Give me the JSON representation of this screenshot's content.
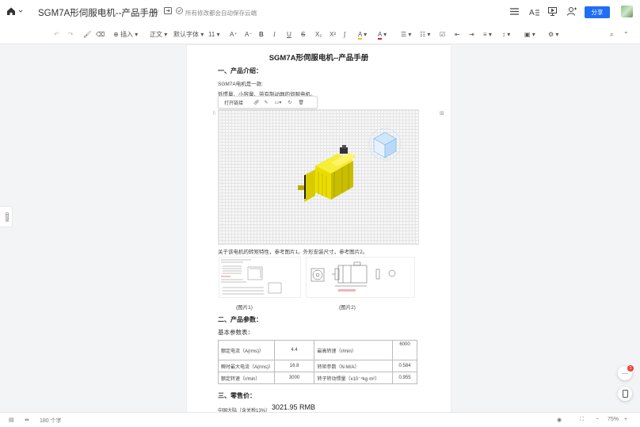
{
  "titlebar": {
    "title": "SGM7A形伺服电机--产品手册",
    "save_status": "所有修改都会自动保存云端",
    "share_label": "分享"
  },
  "toolbar": {
    "insert_label": "插入",
    "style_label": "正文",
    "font_label": "默认字体",
    "size_label": "11"
  },
  "document": {
    "heading": "SGM7A形伺服电机--产品手册",
    "section1_title": "一、产品介绍：",
    "intro_line1": "SGM7A电机是一款:",
    "intro_line2": "低惯量、小容量、带有制动器的伺服电机。",
    "image_popup": {
      "open_link": "打开链接"
    },
    "ref_text": "关于该电机的转矩特性，参考图片1。外形安装尺寸，参考图片2。",
    "caption1": "(图片1)",
    "caption2": "(图片2)",
    "section2_title": "二、产品参数：",
    "basic_params": "基本参数表：",
    "table": [
      [
        "额定电流（A(rms)）",
        "4.4",
        "最高转速（r/min）",
        "6000"
      ],
      [
        "瞬时最大电流（A(rms)）",
        "16.8",
        "转矩参数（N·M/A）",
        "0.584"
      ],
      [
        "额定转速（r/min）",
        "3000",
        "转子转动惯量（x10⁻⁴kg·m²）",
        "0.955"
      ]
    ],
    "section3_title": "三、零售价：",
    "price_label": "中国大陆（含关税13%）",
    "price_value": "3021.95   RMB"
  },
  "sidebar": {
    "outline_label": "目录"
  },
  "notifications": {
    "count": "1"
  },
  "statusbar": {
    "word_count": "180 个字",
    "zoom": "75%"
  },
  "colors": {
    "accent": "#1f6ef5",
    "motor_yellow": "#f2e600",
    "badge": "#f04134"
  }
}
